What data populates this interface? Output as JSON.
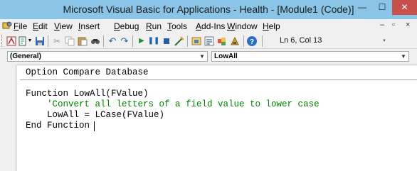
{
  "window": {
    "title": "Microsoft Visual Basic for Applications - Health - [Module1 (Code)]",
    "minimize_glyph": "—",
    "maximize_glyph": "☐",
    "close_glyph": "✕"
  },
  "menubar": {
    "items": [
      "File",
      "Edit",
      "View",
      "Insert",
      "Debug",
      "Run",
      "Tools",
      "Add-Ins",
      "Window",
      "Help"
    ],
    "doc_minimize": "–",
    "doc_restore": "▫",
    "doc_close": "×"
  },
  "toolbar": {
    "status": "Ln 6, Col 13",
    "icons": [
      "access-icon",
      "insert-module-icon",
      "save-icon",
      "cut-icon",
      "copy-icon",
      "paste-icon",
      "find-icon",
      "undo-icon",
      "redo-icon",
      "run-icon",
      "break-icon",
      "reset-icon",
      "design-mode-icon",
      "project-explorer-icon",
      "properties-icon",
      "object-browser-icon",
      "toolbox-icon",
      "help-icon"
    ]
  },
  "code_window": {
    "object_combo": "(General)",
    "procedure_combo": "LowAll",
    "lines": [
      "Option Compare Database",
      "",
      "Function LowAll(FValue)",
      "    'Convert all letters of a field value to lower case",
      "    LowAll = LCase(FValue)",
      "End Function"
    ]
  }
}
